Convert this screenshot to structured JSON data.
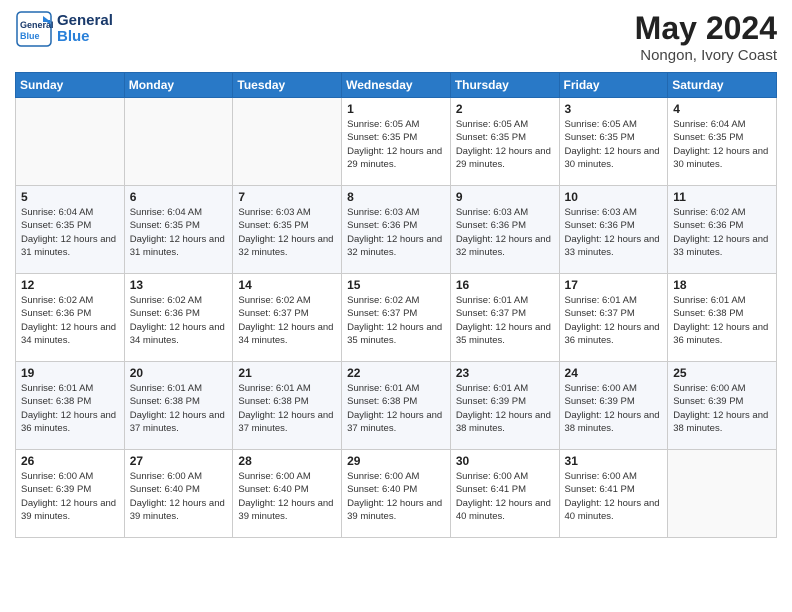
{
  "header": {
    "logo_general": "General",
    "logo_blue": "Blue",
    "title": "May 2024",
    "location": "Nongon, Ivory Coast"
  },
  "weekdays": [
    "Sunday",
    "Monday",
    "Tuesday",
    "Wednesday",
    "Thursday",
    "Friday",
    "Saturday"
  ],
  "weeks": [
    [
      {
        "day": "",
        "info": ""
      },
      {
        "day": "",
        "info": ""
      },
      {
        "day": "",
        "info": ""
      },
      {
        "day": "1",
        "info": "Sunrise: 6:05 AM\nSunset: 6:35 PM\nDaylight: 12 hours\nand 29 minutes."
      },
      {
        "day": "2",
        "info": "Sunrise: 6:05 AM\nSunset: 6:35 PM\nDaylight: 12 hours\nand 29 minutes."
      },
      {
        "day": "3",
        "info": "Sunrise: 6:05 AM\nSunset: 6:35 PM\nDaylight: 12 hours\nand 30 minutes."
      },
      {
        "day": "4",
        "info": "Sunrise: 6:04 AM\nSunset: 6:35 PM\nDaylight: 12 hours\nand 30 minutes."
      }
    ],
    [
      {
        "day": "5",
        "info": "Sunrise: 6:04 AM\nSunset: 6:35 PM\nDaylight: 12 hours\nand 31 minutes."
      },
      {
        "day": "6",
        "info": "Sunrise: 6:04 AM\nSunset: 6:35 PM\nDaylight: 12 hours\nand 31 minutes."
      },
      {
        "day": "7",
        "info": "Sunrise: 6:03 AM\nSunset: 6:35 PM\nDaylight: 12 hours\nand 32 minutes."
      },
      {
        "day": "8",
        "info": "Sunrise: 6:03 AM\nSunset: 6:36 PM\nDaylight: 12 hours\nand 32 minutes."
      },
      {
        "day": "9",
        "info": "Sunrise: 6:03 AM\nSunset: 6:36 PM\nDaylight: 12 hours\nand 32 minutes."
      },
      {
        "day": "10",
        "info": "Sunrise: 6:03 AM\nSunset: 6:36 PM\nDaylight: 12 hours\nand 33 minutes."
      },
      {
        "day": "11",
        "info": "Sunrise: 6:02 AM\nSunset: 6:36 PM\nDaylight: 12 hours\nand 33 minutes."
      }
    ],
    [
      {
        "day": "12",
        "info": "Sunrise: 6:02 AM\nSunset: 6:36 PM\nDaylight: 12 hours\nand 34 minutes."
      },
      {
        "day": "13",
        "info": "Sunrise: 6:02 AM\nSunset: 6:36 PM\nDaylight: 12 hours\nand 34 minutes."
      },
      {
        "day": "14",
        "info": "Sunrise: 6:02 AM\nSunset: 6:37 PM\nDaylight: 12 hours\nand 34 minutes."
      },
      {
        "day": "15",
        "info": "Sunrise: 6:02 AM\nSunset: 6:37 PM\nDaylight: 12 hours\nand 35 minutes."
      },
      {
        "day": "16",
        "info": "Sunrise: 6:01 AM\nSunset: 6:37 PM\nDaylight: 12 hours\nand 35 minutes."
      },
      {
        "day": "17",
        "info": "Sunrise: 6:01 AM\nSunset: 6:37 PM\nDaylight: 12 hours\nand 36 minutes."
      },
      {
        "day": "18",
        "info": "Sunrise: 6:01 AM\nSunset: 6:38 PM\nDaylight: 12 hours\nand 36 minutes."
      }
    ],
    [
      {
        "day": "19",
        "info": "Sunrise: 6:01 AM\nSunset: 6:38 PM\nDaylight: 12 hours\nand 36 minutes."
      },
      {
        "day": "20",
        "info": "Sunrise: 6:01 AM\nSunset: 6:38 PM\nDaylight: 12 hours\nand 37 minutes."
      },
      {
        "day": "21",
        "info": "Sunrise: 6:01 AM\nSunset: 6:38 PM\nDaylight: 12 hours\nand 37 minutes."
      },
      {
        "day": "22",
        "info": "Sunrise: 6:01 AM\nSunset: 6:38 PM\nDaylight: 12 hours\nand 37 minutes."
      },
      {
        "day": "23",
        "info": "Sunrise: 6:01 AM\nSunset: 6:39 PM\nDaylight: 12 hours\nand 38 minutes."
      },
      {
        "day": "24",
        "info": "Sunrise: 6:00 AM\nSunset: 6:39 PM\nDaylight: 12 hours\nand 38 minutes."
      },
      {
        "day": "25",
        "info": "Sunrise: 6:00 AM\nSunset: 6:39 PM\nDaylight: 12 hours\nand 38 minutes."
      }
    ],
    [
      {
        "day": "26",
        "info": "Sunrise: 6:00 AM\nSunset: 6:39 PM\nDaylight: 12 hours\nand 39 minutes."
      },
      {
        "day": "27",
        "info": "Sunrise: 6:00 AM\nSunset: 6:40 PM\nDaylight: 12 hours\nand 39 minutes."
      },
      {
        "day": "28",
        "info": "Sunrise: 6:00 AM\nSunset: 6:40 PM\nDaylight: 12 hours\nand 39 minutes."
      },
      {
        "day": "29",
        "info": "Sunrise: 6:00 AM\nSunset: 6:40 PM\nDaylight: 12 hours\nand 39 minutes."
      },
      {
        "day": "30",
        "info": "Sunrise: 6:00 AM\nSunset: 6:41 PM\nDaylight: 12 hours\nand 40 minutes."
      },
      {
        "day": "31",
        "info": "Sunrise: 6:00 AM\nSunset: 6:41 PM\nDaylight: 12 hours\nand 40 minutes."
      },
      {
        "day": "",
        "info": ""
      }
    ]
  ]
}
